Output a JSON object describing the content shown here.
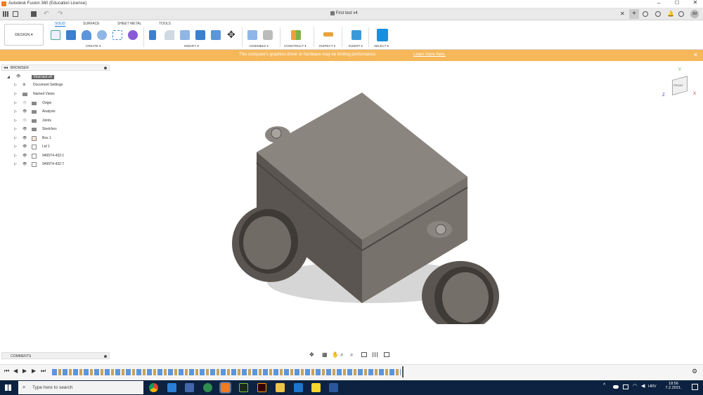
{
  "window": {
    "title": "Autodesk Fusion 360 (Education License)"
  },
  "doc_tab": {
    "name": "First test v4"
  },
  "user": {
    "initials": "JM"
  },
  "workspace": {
    "label": "DESIGN ▾"
  },
  "ribbon": {
    "tabs": [
      "SOLID",
      "SURFACE",
      "SHEET METAL",
      "TOOLS"
    ],
    "groups": [
      "CREATE ▾",
      "MODIFY ▾",
      "ASSEMBLE ▾",
      "CONSTRUCT ▾",
      "INSPECT ▾",
      "INSERT ▾",
      "SELECT ▾"
    ]
  },
  "banner": {
    "message": "This computer's graphics driver or hardware may be limiting performance.",
    "link": "Learn more here."
  },
  "browser": {
    "title": "BROWSER",
    "root": "First test v4",
    "items": [
      "Document Settings",
      "Named Views",
      "Origin",
      "Analysis",
      "Joints",
      "Sketches",
      "Box 1",
      "Lid 1",
      "9495T4-432:1",
      "9495T4-432:7"
    ]
  },
  "comments": {
    "label": "COMMENTS"
  },
  "viewcube": {
    "face": "FRONT",
    "axis_x": "X",
    "axis_y": "Y",
    "axis_z": "Z"
  },
  "taskbar": {
    "search_placeholder": "Type here to search",
    "lang": "HRV",
    "time": "18:56",
    "date": "7.2.2021."
  },
  "colors": {
    "accent": "#1a6fd1",
    "banner": "#f6b759",
    "taskbar": "#0c2240"
  }
}
